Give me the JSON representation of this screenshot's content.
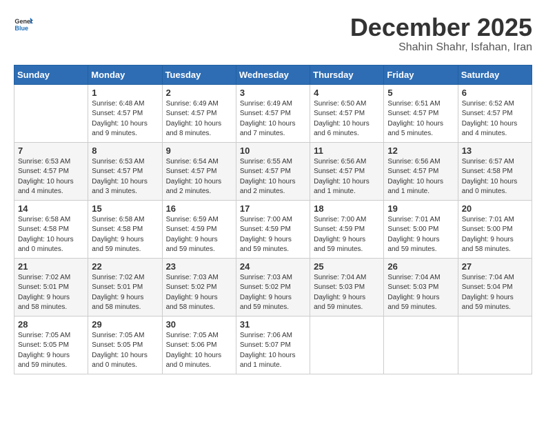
{
  "logo": {
    "general": "General",
    "blue": "Blue"
  },
  "header": {
    "month": "December 2025",
    "location": "Shahin Shahr, Isfahan, Iran"
  },
  "weekdays": [
    "Sunday",
    "Monday",
    "Tuesday",
    "Wednesday",
    "Thursday",
    "Friday",
    "Saturday"
  ],
  "weeks": [
    [
      {
        "day": "",
        "info": ""
      },
      {
        "day": "1",
        "info": "Sunrise: 6:48 AM\nSunset: 4:57 PM\nDaylight: 10 hours\nand 9 minutes."
      },
      {
        "day": "2",
        "info": "Sunrise: 6:49 AM\nSunset: 4:57 PM\nDaylight: 10 hours\nand 8 minutes."
      },
      {
        "day": "3",
        "info": "Sunrise: 6:49 AM\nSunset: 4:57 PM\nDaylight: 10 hours\nand 7 minutes."
      },
      {
        "day": "4",
        "info": "Sunrise: 6:50 AM\nSunset: 4:57 PM\nDaylight: 10 hours\nand 6 minutes."
      },
      {
        "day": "5",
        "info": "Sunrise: 6:51 AM\nSunset: 4:57 PM\nDaylight: 10 hours\nand 5 minutes."
      },
      {
        "day": "6",
        "info": "Sunrise: 6:52 AM\nSunset: 4:57 PM\nDaylight: 10 hours\nand 4 minutes."
      }
    ],
    [
      {
        "day": "7",
        "info": "Sunrise: 6:53 AM\nSunset: 4:57 PM\nDaylight: 10 hours\nand 4 minutes."
      },
      {
        "day": "8",
        "info": "Sunrise: 6:53 AM\nSunset: 4:57 PM\nDaylight: 10 hours\nand 3 minutes."
      },
      {
        "day": "9",
        "info": "Sunrise: 6:54 AM\nSunset: 4:57 PM\nDaylight: 10 hours\nand 2 minutes."
      },
      {
        "day": "10",
        "info": "Sunrise: 6:55 AM\nSunset: 4:57 PM\nDaylight: 10 hours\nand 2 minutes."
      },
      {
        "day": "11",
        "info": "Sunrise: 6:56 AM\nSunset: 4:57 PM\nDaylight: 10 hours\nand 1 minute."
      },
      {
        "day": "12",
        "info": "Sunrise: 6:56 AM\nSunset: 4:57 PM\nDaylight: 10 hours\nand 1 minute."
      },
      {
        "day": "13",
        "info": "Sunrise: 6:57 AM\nSunset: 4:58 PM\nDaylight: 10 hours\nand 0 minutes."
      }
    ],
    [
      {
        "day": "14",
        "info": "Sunrise: 6:58 AM\nSunset: 4:58 PM\nDaylight: 10 hours\nand 0 minutes."
      },
      {
        "day": "15",
        "info": "Sunrise: 6:58 AM\nSunset: 4:58 PM\nDaylight: 9 hours\nand 59 minutes."
      },
      {
        "day": "16",
        "info": "Sunrise: 6:59 AM\nSunset: 4:59 PM\nDaylight: 9 hours\nand 59 minutes."
      },
      {
        "day": "17",
        "info": "Sunrise: 7:00 AM\nSunset: 4:59 PM\nDaylight: 9 hours\nand 59 minutes."
      },
      {
        "day": "18",
        "info": "Sunrise: 7:00 AM\nSunset: 4:59 PM\nDaylight: 9 hours\nand 59 minutes."
      },
      {
        "day": "19",
        "info": "Sunrise: 7:01 AM\nSunset: 5:00 PM\nDaylight: 9 hours\nand 59 minutes."
      },
      {
        "day": "20",
        "info": "Sunrise: 7:01 AM\nSunset: 5:00 PM\nDaylight: 9 hours\nand 58 minutes."
      }
    ],
    [
      {
        "day": "21",
        "info": "Sunrise: 7:02 AM\nSunset: 5:01 PM\nDaylight: 9 hours\nand 58 minutes."
      },
      {
        "day": "22",
        "info": "Sunrise: 7:02 AM\nSunset: 5:01 PM\nDaylight: 9 hours\nand 58 minutes."
      },
      {
        "day": "23",
        "info": "Sunrise: 7:03 AM\nSunset: 5:02 PM\nDaylight: 9 hours\nand 58 minutes."
      },
      {
        "day": "24",
        "info": "Sunrise: 7:03 AM\nSunset: 5:02 PM\nDaylight: 9 hours\nand 59 minutes."
      },
      {
        "day": "25",
        "info": "Sunrise: 7:04 AM\nSunset: 5:03 PM\nDaylight: 9 hours\nand 59 minutes."
      },
      {
        "day": "26",
        "info": "Sunrise: 7:04 AM\nSunset: 5:03 PM\nDaylight: 9 hours\nand 59 minutes."
      },
      {
        "day": "27",
        "info": "Sunrise: 7:04 AM\nSunset: 5:04 PM\nDaylight: 9 hours\nand 59 minutes."
      }
    ],
    [
      {
        "day": "28",
        "info": "Sunrise: 7:05 AM\nSunset: 5:05 PM\nDaylight: 9 hours\nand 59 minutes."
      },
      {
        "day": "29",
        "info": "Sunrise: 7:05 AM\nSunset: 5:05 PM\nDaylight: 10 hours\nand 0 minutes."
      },
      {
        "day": "30",
        "info": "Sunrise: 7:05 AM\nSunset: 5:06 PM\nDaylight: 10 hours\nand 0 minutes."
      },
      {
        "day": "31",
        "info": "Sunrise: 7:06 AM\nSunset: 5:07 PM\nDaylight: 10 hours\nand 1 minute."
      },
      {
        "day": "",
        "info": ""
      },
      {
        "day": "",
        "info": ""
      },
      {
        "day": "",
        "info": ""
      }
    ]
  ]
}
